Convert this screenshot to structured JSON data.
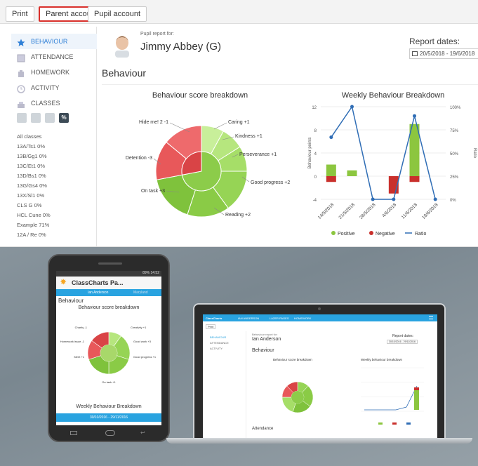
{
  "toolbar": {
    "print": "Print",
    "parent": "Parent account",
    "pupil": "Pupil account"
  },
  "sidebar": {
    "items": [
      {
        "label": "BEHAVIOUR",
        "icon": "star-icon"
      },
      {
        "label": "ATTENDANCE",
        "icon": "register-icon"
      },
      {
        "label": "HOMEWORK",
        "icon": "homework-icon"
      },
      {
        "label": "ACTIVITY",
        "icon": "clock-icon"
      },
      {
        "label": "CLASSES",
        "icon": "classes-icon"
      }
    ],
    "pct_button": "%",
    "classes": [
      "All classes",
      "13A/Ts1   0%",
      "13B/Gg1   0%",
      "13C/Et1   0%",
      "13D/Bs1   0%",
      "13G/Gs4   0%",
      "13X/Sl1   0%",
      "CLS G   0%",
      "HCL Cune   0%",
      "Example   71%",
      "12A / Re   0%"
    ]
  },
  "header": {
    "report_for": "Pupil report for:",
    "pupil_name": "Jimmy Abbey (G)",
    "report_dates_label": "Report dates:",
    "report_dates": "20/5/2018 - 19/6/2018"
  },
  "section_title": "Behaviour",
  "pie_title": "Behaviour score breakdown",
  "pie_labels": [
    "Hide me! 2 -1",
    "Caring +1",
    "Kindness +1",
    "Perseverance +1",
    "Good progress +2",
    "Reading +2",
    "On task +3",
    "Detention -3"
  ],
  "weekly_title": "Weekly Behaviour Breakdown",
  "legend": {
    "positive": "Positive",
    "negative": "Negative",
    "ratio": "Ratio"
  },
  "chart_data": {
    "type": "bar",
    "categories": [
      "14/5/2018",
      "21/5/2018",
      "28/5/2018",
      "4/6/2018",
      "11/6/2018",
      "18/6/2018"
    ],
    "series": [
      {
        "name": "Positive",
        "values": [
          2,
          1,
          0,
          0,
          9,
          0
        ]
      },
      {
        "name": "Negative",
        "values": [
          -1,
          0,
          0,
          -3,
          -1,
          0
        ]
      },
      {
        "name": "Ratio",
        "values": [
          67,
          100,
          0,
          0,
          90,
          0
        ]
      }
    ],
    "ylabel": "Behaviour points",
    "y2label": "Ratio",
    "ylim": [
      -4,
      12
    ],
    "yticks": [
      -4,
      0,
      4,
      8,
      12
    ],
    "y2ticks": [
      "0%",
      "25%",
      "50%",
      "75%",
      "100%"
    ]
  },
  "phone": {
    "status": "89% 14:52",
    "app_title": "ClassCharts Pa...",
    "tab_left": "Ian Anderson",
    "tab_right": "Maryland",
    "section": "Behaviour",
    "pie_title": "Behaviour score breakdown",
    "labels": [
      "Charity -1",
      "Creativity +1",
      "Homework issue -1",
      "Good work +3",
      "Merit +1",
      "Good progress +1",
      "On task +1"
    ],
    "weekly": "Weekly Behaviour Breakdown",
    "dates": "30/10/2016 - 29/11/2016"
  },
  "laptop": {
    "brand": "ClassCharts",
    "nav": [
      "IAN ANDERSON",
      "LAZER PAGES",
      "HOMEWORK"
    ],
    "print": "Print",
    "report_for": "Behaviour report for:",
    "name": "Ian Anderson",
    "report_dates": "Report dates:",
    "dates": "30/10/2016 - 29/11/2016",
    "side": [
      "BEHAVIOUR",
      "ATTENDANCE",
      "ACTIVITY"
    ],
    "section": "Behaviour",
    "pie_title": "Behaviour score breakdown",
    "weekly_title": "Weekly behaviour breakdown",
    "attendance": "Attendance"
  }
}
